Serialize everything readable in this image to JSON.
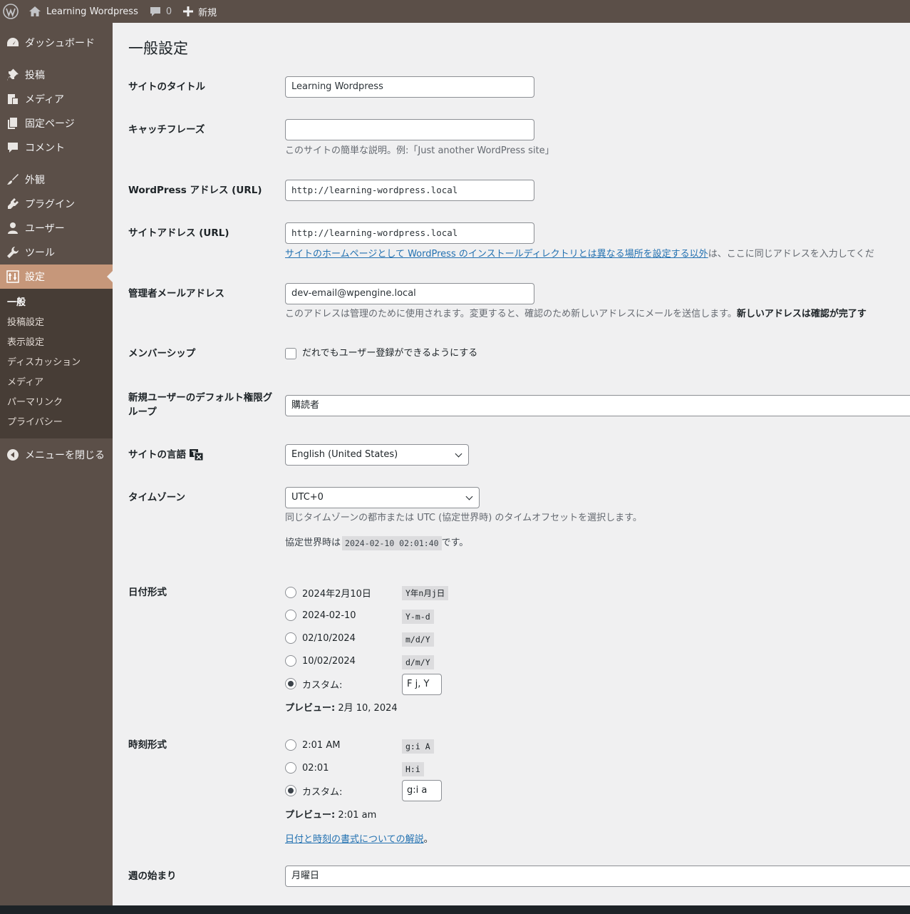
{
  "admin_bar": {
    "site_name": "Learning Wordpress",
    "comments_count": "0",
    "new_label": "新規"
  },
  "sidebar": {
    "items": [
      {
        "label": "ダッシュボード",
        "icon": "dashboard-icon"
      },
      {
        "label": "投稿",
        "icon": "pin-icon"
      },
      {
        "label": "メディア",
        "icon": "media-icon"
      },
      {
        "label": "固定ページ",
        "icon": "page-icon"
      },
      {
        "label": "コメント",
        "icon": "comment-icon"
      },
      {
        "label": "外観",
        "icon": "brush-icon"
      },
      {
        "label": "プラグイン",
        "icon": "plugin-icon"
      },
      {
        "label": "ユーザー",
        "icon": "user-icon"
      },
      {
        "label": "ツール",
        "icon": "wrench-icon"
      },
      {
        "label": "設定",
        "icon": "settings-icon"
      }
    ],
    "submenu": [
      "一般",
      "投稿設定",
      "表示設定",
      "ディスカッション",
      "メディア",
      "パーマリンク",
      "プライバシー"
    ],
    "collapse_label": "メニューを閉じる"
  },
  "page": {
    "title": "一般設定",
    "site_title": {
      "label": "サイトのタイトル",
      "value": "Learning Wordpress"
    },
    "tagline": {
      "label": "キャッチフレーズ",
      "value": "",
      "desc": "このサイトの簡単な説明。例:「Just another WordPress site」"
    },
    "wp_address": {
      "label": "WordPress アドレス (URL)",
      "value": "http://learning-wordpress.local"
    },
    "site_address": {
      "label": "サイトアドレス (URL)",
      "value": "http://learning-wordpress.local",
      "desc_link": "サイトのホームページとして WordPress のインストールディレクトリとは異なる場所を設定する以外",
      "desc_rest": "は、ここに同じアドレスを入力してくだ"
    },
    "admin_email": {
      "label": "管理者メールアドレス",
      "value": "dev-email@wpengine.local",
      "desc": "このアドレスは管理のために使用されます。変更すると、確認のため新しいアドレスにメールを送信します。",
      "desc_bold": "新しいアドレスは確認が完了す"
    },
    "membership": {
      "label": "メンバーシップ",
      "checkbox_label": "だれでもユーザー登録ができるようにする"
    },
    "default_role": {
      "label": "新規ユーザーのデフォルト権限グループ",
      "value": "購読者"
    },
    "language": {
      "label": "サイトの言語",
      "value": "English (United States)"
    },
    "timezone": {
      "label": "タイムゾーン",
      "value": "UTC+0",
      "desc": "同じタイムゾーンの都市または UTC (協定世界時) のタイムオフセットを選択します。",
      "utc_prefix": "協定世界時は",
      "utc_time": "2024-02-10 02:01:40",
      "utc_suffix": "です。"
    },
    "date_format": {
      "label": "日付形式",
      "options": [
        {
          "label": "2024年2月10日",
          "code": "Y年n月j日"
        },
        {
          "label": "2024-02-10",
          "code": "Y-m-d"
        },
        {
          "label": "02/10/2024",
          "code": "m/d/Y"
        },
        {
          "label": "10/02/2024",
          "code": "d/m/Y"
        }
      ],
      "custom_label": "カスタム:",
      "custom_value": "F j, Y",
      "preview_label": "プレビュー:",
      "preview_value": "2月 10, 2024"
    },
    "time_format": {
      "label": "時刻形式",
      "options": [
        {
          "label": "2:01 AM",
          "code": "g:i A"
        },
        {
          "label": "02:01",
          "code": "H:i"
        }
      ],
      "custom_label": "カスタム:",
      "custom_value": "g:i a",
      "preview_label": "プレビュー:",
      "preview_value": "2:01 am",
      "doc_link": "日付と時刻の書式についての解説",
      "doc_suffix": "。"
    },
    "week_start": {
      "label": "週の始まり",
      "value": "月曜日"
    }
  }
}
